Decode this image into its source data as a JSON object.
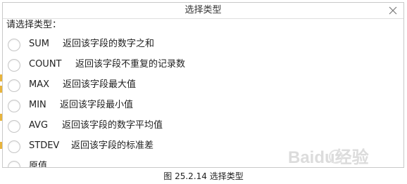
{
  "dialog": {
    "title": "选择类型",
    "prompt": "请选择类型：",
    "options": [
      {
        "name": "SUM",
        "description": "返回该字段的数字之和",
        "selected": false
      },
      {
        "name": "COUNT",
        "description": "返回该字段不重复的记录数",
        "selected": false
      },
      {
        "name": "MAX",
        "description": "返回该字段最大值",
        "selected": false
      },
      {
        "name": "MIN",
        "description": "返回该字段最小值",
        "selected": false
      },
      {
        "name": "AVG",
        "description": "返回该字段的数字平均值",
        "selected": false
      },
      {
        "name": "STDEV",
        "description": "返回该字段的标准差",
        "selected": false
      },
      {
        "name": "原值",
        "description": "",
        "selected": false
      }
    ]
  },
  "watermark": "Baidu经验",
  "caption": "图 25.2.14   选择类型",
  "colors": {
    "border": "#c9c9c9",
    "text": "#222222",
    "radio_border": "#c6c6c6",
    "watermark": "#d8d8d8"
  }
}
